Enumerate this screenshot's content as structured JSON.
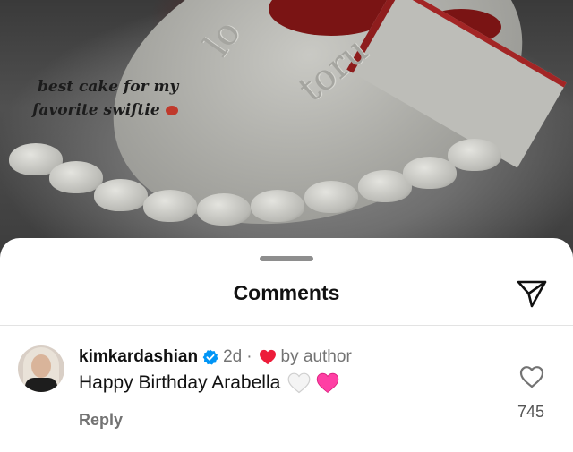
{
  "photo": {
    "caption_line1": "best cake for my",
    "caption_line2": "favorite swiftie",
    "cake_text_1": "lo",
    "cake_text_2": "toru"
  },
  "sheet": {
    "title": "Comments"
  },
  "comment": {
    "username": "kimkardashian",
    "verified": true,
    "time": "2d",
    "separator": "·",
    "liked_by_author_label": "by author",
    "text": "Happy Birthday Arabella",
    "emojis": [
      "white-heart",
      "pink-heart"
    ],
    "reply_label": "Reply",
    "like_count": "745"
  },
  "icons": {
    "share": "paper-plane-icon",
    "verified": "verified-badge-icon",
    "like": "heart-outline-icon",
    "author_like": "red-heart-icon"
  },
  "colors": {
    "verified_blue": "#0095f6",
    "author_heart": "#ed1c3a",
    "pink_heart": "#ff3fa4",
    "muted_text": "#737373"
  }
}
